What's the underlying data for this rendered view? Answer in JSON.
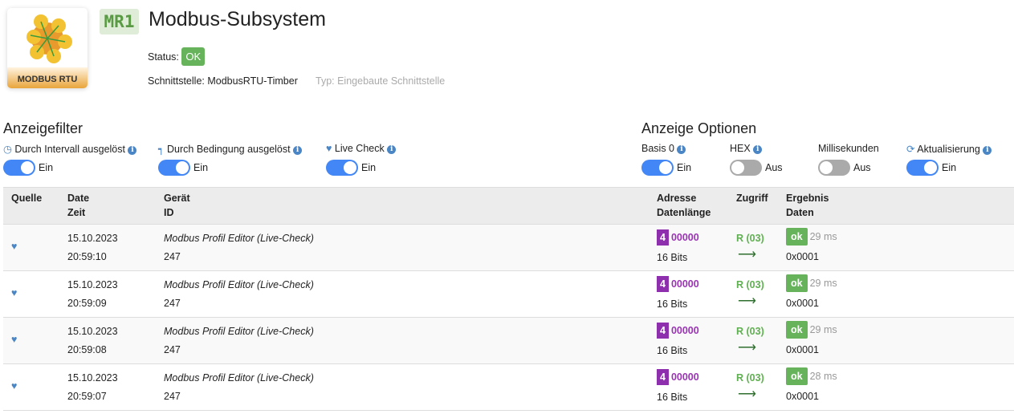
{
  "header": {
    "logo_text": "MODBUS RTU",
    "badge": "MR1",
    "title": "Modbus-Subsystem",
    "status_label": "Status:",
    "status_value": "OK",
    "interface": "Schnittstelle: ModbusRTU-Timber",
    "type": "Typ: Eingebaute Schnittstelle"
  },
  "filter": {
    "title": "Anzeigefilter",
    "items": [
      {
        "label": "Durch Intervall ausgelöst",
        "state": "Ein",
        "on": true
      },
      {
        "label": "Durch Bedingung ausgelöst",
        "state": "Ein",
        "on": true
      },
      {
        "label": "Live Check",
        "state": "Ein",
        "on": true
      }
    ]
  },
  "options": {
    "title": "Anzeige Optionen",
    "items": [
      {
        "label": "Basis 0",
        "state": "Ein",
        "on": true
      },
      {
        "label": "HEX",
        "state": "Aus",
        "on": false
      },
      {
        "label": "Millisekunden",
        "state": "Aus",
        "on": false
      },
      {
        "label": "Aktualisierung",
        "state": "Ein",
        "on": true
      }
    ]
  },
  "table": {
    "headers": {
      "source": "Quelle",
      "date": "Date",
      "time": "Zeit",
      "device": "Gerät",
      "id": "ID",
      "address": "Adresse",
      "length": "Datenlänge",
      "access": "Zugriff",
      "result": "Ergebnis",
      "data": "Daten"
    },
    "rows": [
      {
        "date": "15.10.2023",
        "time": "20:59:10",
        "device": "Modbus Profil Editor (Live-Check)",
        "id": "247",
        "type": "4",
        "address": "00000",
        "length": "16 Bits",
        "access": "R (03)",
        "result": "ok",
        "duration": "29 ms",
        "data": "0x0001"
      },
      {
        "date": "15.10.2023",
        "time": "20:59:09",
        "device": "Modbus Profil Editor (Live-Check)",
        "id": "247",
        "type": "4",
        "address": "00000",
        "length": "16 Bits",
        "access": "R (03)",
        "result": "ok",
        "duration": "29 ms",
        "data": "0x0001"
      },
      {
        "date": "15.10.2023",
        "time": "20:59:08",
        "device": "Modbus Profil Editor (Live-Check)",
        "id": "247",
        "type": "4",
        "address": "00000",
        "length": "16 Bits",
        "access": "R (03)",
        "result": "ok",
        "duration": "29 ms",
        "data": "0x0001"
      },
      {
        "date": "15.10.2023",
        "time": "20:59:07",
        "device": "Modbus Profil Editor (Live-Check)",
        "id": "247",
        "type": "4",
        "address": "00000",
        "length": "16 Bits",
        "access": "R (03)",
        "result": "ok",
        "duration": "28 ms",
        "data": "0x0001"
      }
    ]
  }
}
